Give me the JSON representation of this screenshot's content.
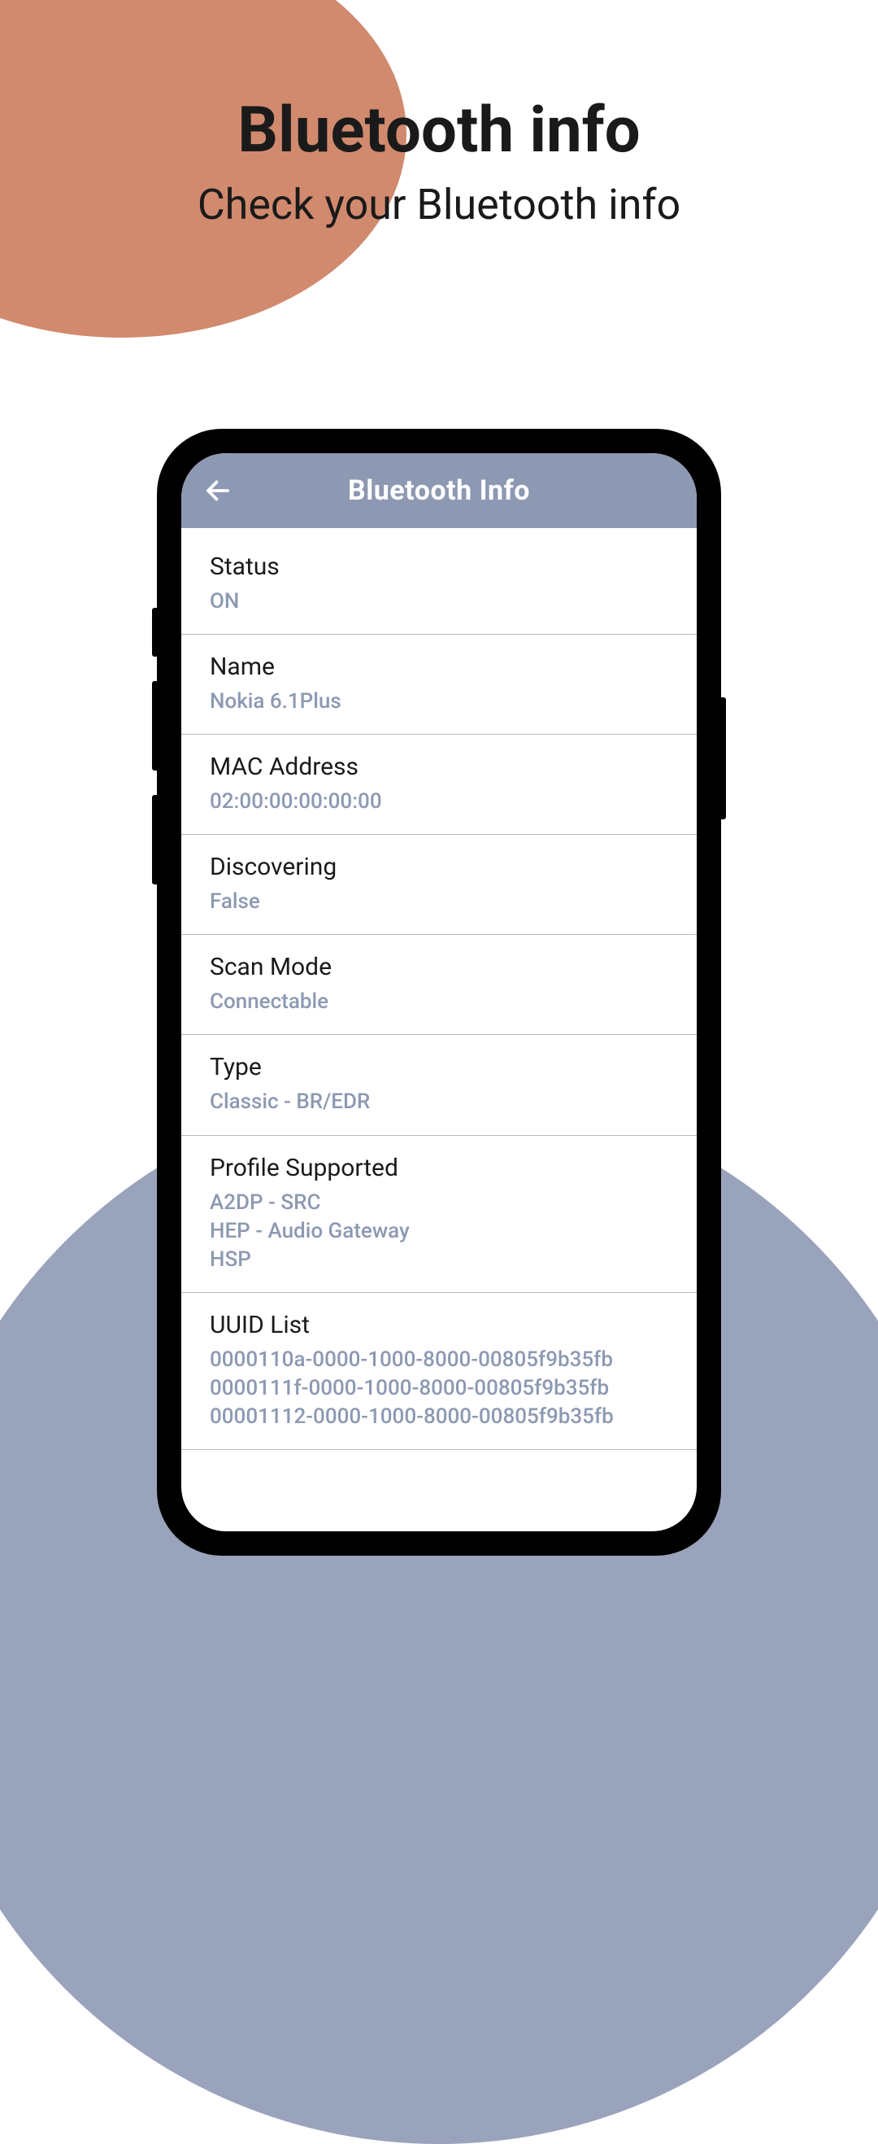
{
  "page": {
    "title": "Bluetooth info",
    "subtitle": "Check your Bluetooth info"
  },
  "header": {
    "title": "Bluetooth Info"
  },
  "rows": [
    {
      "label": "Status",
      "value": "ON"
    },
    {
      "label": "Name",
      "value": "Nokia 6.1Plus"
    },
    {
      "label": "MAC Address",
      "value": "02:00:00:00:00:00"
    },
    {
      "label": "Discovering",
      "value": "False"
    },
    {
      "label": "Scan Mode",
      "value": "Connectable"
    },
    {
      "label": "Type",
      "value": "Classic - BR/EDR"
    },
    {
      "label": "Profile Supported",
      "value": "A2DP - SRC\nHEP - Audio Gateway\nHSP"
    },
    {
      "label": "UUID List",
      "value": "0000110a-0000-1000-8000-00805f9b35fb\n0000111f-0000-1000-8000-00805f9b35fb\n00001112-0000-1000-8000-00805f9b35fb"
    }
  ]
}
